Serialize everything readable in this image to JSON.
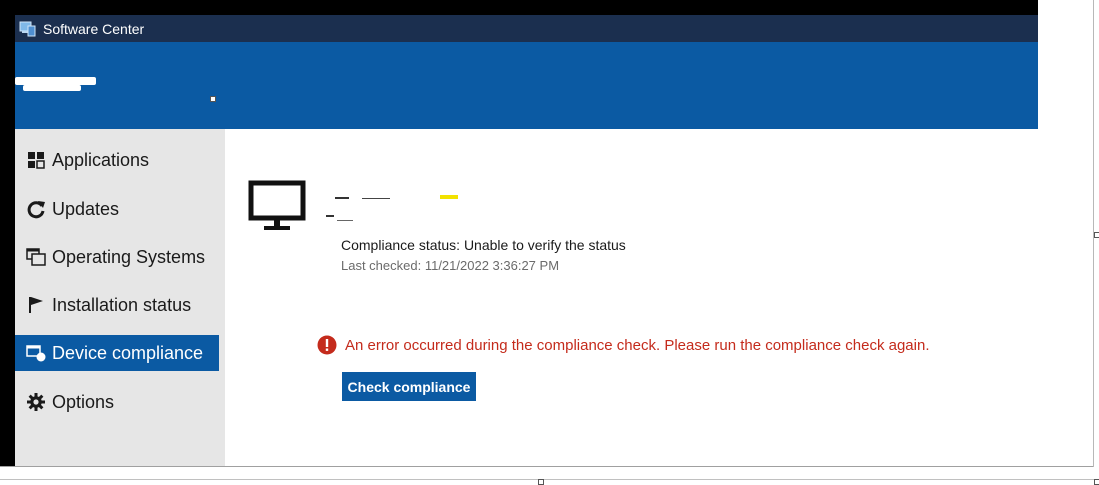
{
  "window": {
    "title": "Software Center"
  },
  "sidebar": {
    "items": [
      {
        "label": "Applications",
        "icon": "applications-icon"
      },
      {
        "label": "Updates",
        "icon": "refresh-icon"
      },
      {
        "label": "Operating Systems",
        "icon": "windows-icon"
      },
      {
        "label": "Installation status",
        "icon": "flag-icon"
      },
      {
        "label": "Device compliance",
        "icon": "device-compliance-icon",
        "selected": true
      },
      {
        "label": "Options",
        "icon": "gear-icon"
      }
    ]
  },
  "main": {
    "compliance_status": "Compliance status: Unable to verify the status",
    "last_checked": "Last checked: 11/21/2022 3:36:27 PM",
    "error_message": "An error occurred during the compliance check. Please run the compliance check again.",
    "check_button_label": "Check compliance"
  },
  "colors": {
    "title_bar": "#1b2f4f",
    "header": "#0b5aa3",
    "sidebar": "#e6e6e6",
    "selected": "#0b5aa3",
    "error": "#c42b1c"
  }
}
